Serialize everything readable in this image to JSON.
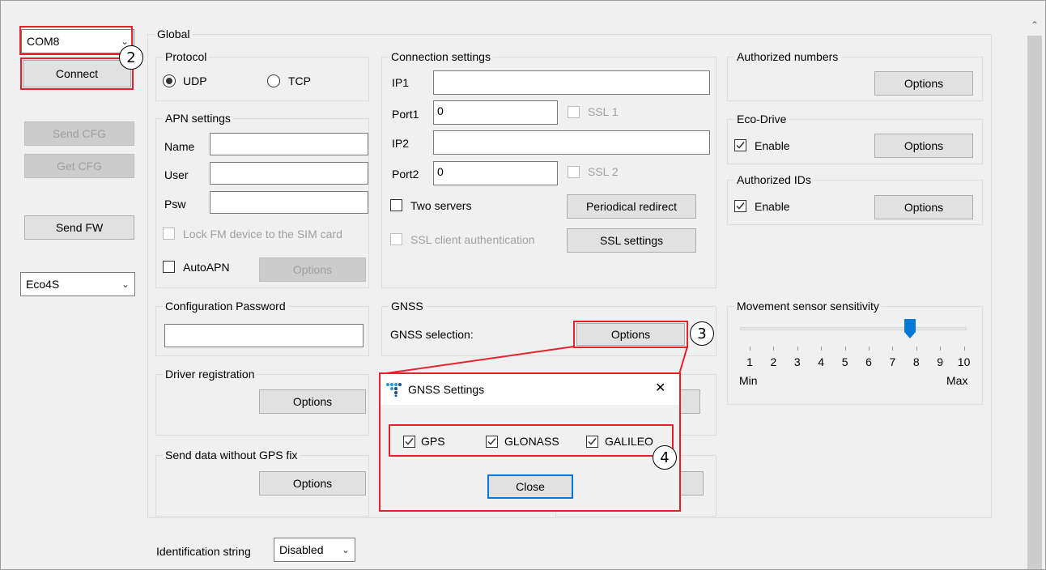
{
  "left_panel": {
    "port_select": "COM8",
    "connect_label": "Connect",
    "send_cfg_label": "Send CFG",
    "get_cfg_label": "Get CFG",
    "send_fw_label": "Send FW",
    "device_select": "Eco4S"
  },
  "global": {
    "title": "Global",
    "protocol": {
      "title": "Protocol",
      "udp": "UDP",
      "tcp": "TCP",
      "selected": "UDP"
    },
    "apn": {
      "title": "APN settings",
      "name_label": "Name",
      "user_label": "User",
      "psw_label": "Psw",
      "name_value": "",
      "user_value": "",
      "psw_value": "",
      "lock_label": "Lock FM device to the SIM card",
      "autoapn_label": "AutoAPN",
      "options_label": "Options"
    },
    "connection": {
      "title": "Connection settings",
      "ip1_label": "IP1",
      "ip1_value": "",
      "port1_label": "Port1",
      "port1_value": "0",
      "ssl1_label": "SSL 1",
      "ip2_label": "IP2",
      "ip2_value": "",
      "port2_label": "Port2",
      "port2_value": "0",
      "ssl2_label": "SSL 2",
      "two_servers_label": "Two servers",
      "periodical_redirect_label": "Periodical redirect",
      "ssl_client_auth_label": "SSL client authentication",
      "ssl_settings_label": "SSL settings"
    },
    "authorized_numbers": {
      "title": "Authorized numbers",
      "options_label": "Options"
    },
    "eco_drive": {
      "title": "Eco-Drive",
      "enable_label": "Enable",
      "enabled": true,
      "options_label": "Options"
    },
    "authorized_ids": {
      "title": "Authorized IDs",
      "enable_label": "Enable",
      "enabled": true,
      "options_label": "Options"
    },
    "config_password": {
      "title": "Configuration Password",
      "value": ""
    },
    "gnss": {
      "title": "GNSS",
      "selection_label": "GNSS selection:",
      "options_label": "Options"
    },
    "movement": {
      "title": "Movement sensor sensitivity",
      "numbers": [
        "1",
        "2",
        "3",
        "4",
        "5",
        "6",
        "7",
        "8",
        "9",
        "10"
      ],
      "value": 8,
      "min_label": "Min",
      "max_label": "Max"
    },
    "driver_registration": {
      "title": "Driver registration",
      "options_label": "Options"
    },
    "send_data_no_fix": {
      "title": "Send data without GPS fix",
      "options_label": "Options"
    },
    "identification": {
      "label": "Identification string",
      "value": "Disabled"
    }
  },
  "dialog": {
    "title": "GNSS Settings",
    "close_x": "✕",
    "gps_label": "GPS",
    "glonass_label": "GLONASS",
    "galileo_label": "GALILEO",
    "gps": true,
    "glonass": true,
    "galileo": true,
    "close_label": "Close"
  },
  "callouts": {
    "c2": "2",
    "c3": "3",
    "c4": "4"
  },
  "colors": {
    "highlight": "#e8212a",
    "focus_border": "#0078d7",
    "slider_thumb": "#0078d7"
  }
}
